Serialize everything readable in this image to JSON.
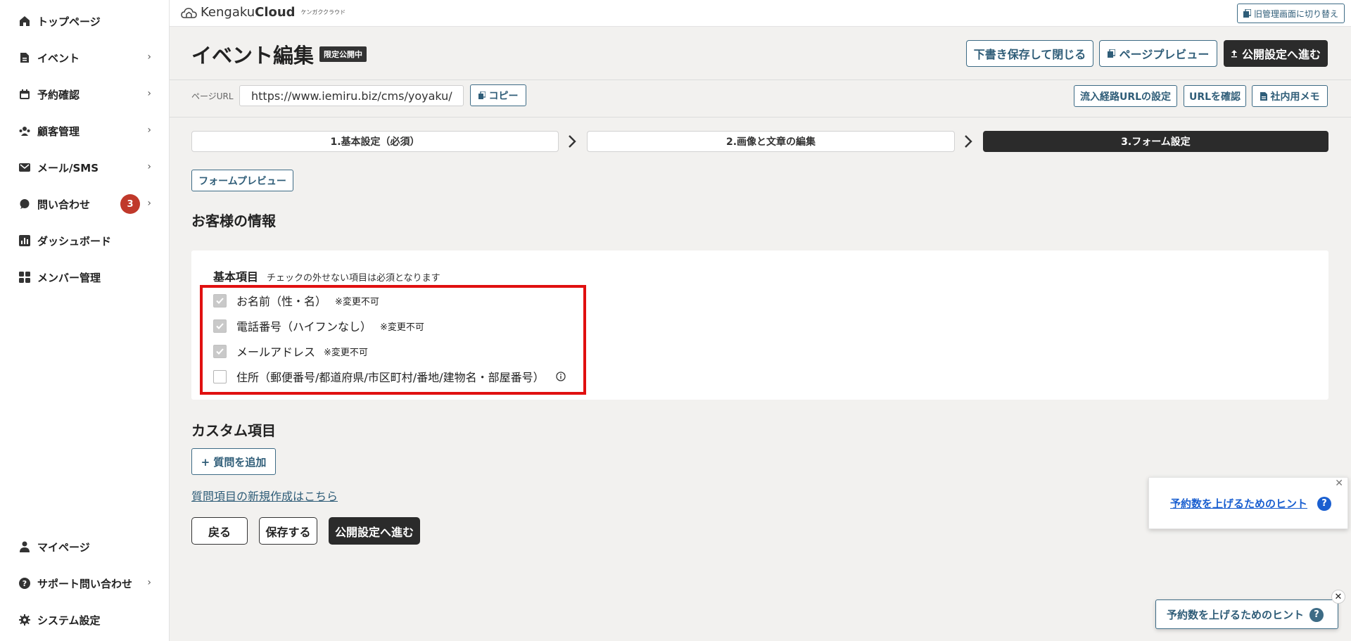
{
  "sidebar": {
    "items": [
      {
        "label": "トップページ",
        "icon": "home-icon"
      },
      {
        "label": "イベント",
        "icon": "document-icon"
      },
      {
        "label": "予約確認",
        "icon": "calendar-icon"
      },
      {
        "label": "顧客管理",
        "icon": "customers-icon"
      },
      {
        "label": "メール/SMS",
        "icon": "mail-icon"
      },
      {
        "label": "問い合わせ",
        "icon": "chat-icon",
        "badge": "3"
      },
      {
        "label": "ダッシュボード",
        "icon": "chart-icon"
      },
      {
        "label": "メンバー管理",
        "icon": "grid-icon"
      }
    ],
    "bottom_items": [
      {
        "label": "マイページ",
        "icon": "user-icon"
      },
      {
        "label": "サポート問い合わせ",
        "icon": "help-icon"
      },
      {
        "label": "システム設定",
        "icon": "gear-icon"
      }
    ]
  },
  "topbar": {
    "logo_regular": "Kengaku",
    "logo_bold": "Cloud",
    "logo_kana": "ケンガククラウド",
    "switch_label": "旧管理画面に切り替え"
  },
  "header": {
    "title": "イベント編集",
    "status_badge": "限定公開中",
    "draft_save_close": "下書き保存して閉じる",
    "page_preview": "ページプレビュー",
    "publish_settings": "公開設定へ進む"
  },
  "url_bar": {
    "label": "ページURL",
    "value": "https://www.iemiru.biz/cms/yoyaku/",
    "copy": "コピー",
    "inflow_url": "流入経路URLの設定",
    "check_url": "URLを確認",
    "internal_memo": "社内用メモ"
  },
  "steps": [
    {
      "label": "1.基本設定（必須）",
      "active": false
    },
    {
      "label": "2.画像と文章の編集",
      "active": false
    },
    {
      "label": "3.フォーム設定",
      "active": true
    }
  ],
  "form_preview": "フォームプレビュー",
  "customer_info": {
    "title": "お客様の情報",
    "basic_heading": "基本項目",
    "basic_note": "チェックの外せない項目は必須となります",
    "fields": [
      {
        "label": "お名前（性・名）",
        "note": "※変更不可",
        "checked": true
      },
      {
        "label": "電話番号（ハイフンなし）",
        "note": "※変更不可",
        "checked": true
      },
      {
        "label": "メールアドレス",
        "note": "※変更不可",
        "checked": true
      },
      {
        "label": "住所（郵便番号/都道府県/市区町村/番地/建物名・部屋番号）",
        "note": "",
        "checked": false
      }
    ]
  },
  "custom": {
    "title": "カスタム項目",
    "add_question": "+ 質問を追加",
    "new_link": "質問項目の新規作成はこちら"
  },
  "footer_buttons": {
    "back": "戻る",
    "save": "保存する",
    "publish": "公開設定へ進む"
  },
  "hints": {
    "popup_label": "予約数を上げるためのヒント",
    "button_label": "予約数を上げるためのヒント",
    "q": "?"
  },
  "colors": {
    "primary_dark": "#2b2b2b",
    "accent_blue": "#2f5d78",
    "badge_red": "#c0392b",
    "highlight_red": "#e01010",
    "hint_blue": "#1a5fd0"
  }
}
